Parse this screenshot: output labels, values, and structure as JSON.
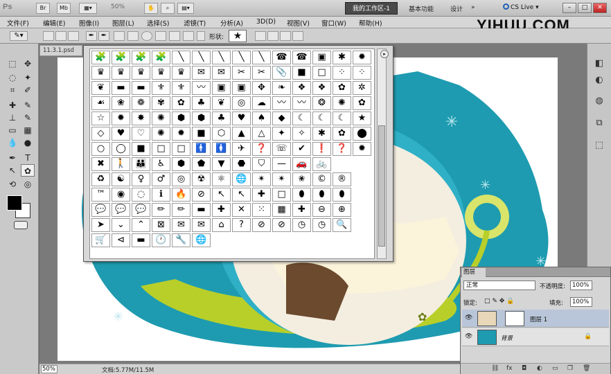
{
  "app": {
    "logo": "Ps",
    "zoom": "50%",
    "workspace": "我的工作区-1",
    "workspace_links": [
      "基本功能",
      "设计"
    ],
    "cs_live": "CS Live"
  },
  "menus": [
    "文件(F)",
    "编辑(E)",
    "图像(I)",
    "图层(L)",
    "选择(S)",
    "滤镜(T)",
    "分析(A)",
    "3D(D)",
    "视图(V)",
    "窗口(W)",
    "帮助(H)"
  ],
  "watermark_logo": "YIHUU.COM",
  "options": {
    "shape_label": "形状:"
  },
  "document": {
    "tab": "11.3.1.psd",
    "zoom": "50%",
    "doc_size": "文档:5.77M/11.5M"
  },
  "shapes": [
    "🧩",
    "🧩",
    "🧩",
    "🧩",
    "╲",
    "╲",
    "╲",
    "╲",
    "╲",
    "☎",
    "☎",
    "▣",
    "✱",
    "✹",
    "♛",
    "♛",
    "♛",
    "♛",
    "♛",
    "✉",
    "✉",
    "✂",
    "✂",
    "📎",
    "■",
    "□",
    "⁘",
    "⁘",
    "❦",
    "▬",
    "▬",
    "⚜",
    "⚜",
    "〰",
    "▣",
    "▣",
    "✥",
    "❧",
    "❖",
    "❖",
    "✿",
    "✲",
    "☙",
    "❀",
    "❁",
    "✾",
    "✿",
    "♣",
    "❦",
    "◎",
    "☁",
    "〰",
    "〰",
    "❂",
    "✺",
    "✿",
    "☆",
    "✹",
    "✸",
    "✺",
    "⬢",
    "⬢",
    "♣",
    "♥",
    "♠",
    "◆",
    "☾",
    "☾",
    "☾",
    "★",
    "◇",
    "♥",
    "♡",
    "✺",
    "✹",
    "■",
    "⬡",
    "▲",
    "△",
    "✦",
    "✧",
    "✱",
    "✿",
    "⬤",
    "○",
    "◯",
    "■",
    "□",
    "□",
    "🚹",
    "🚺",
    "✈",
    "❓",
    "☏",
    "✔",
    "❗",
    "❓",
    "✹",
    "✖",
    "🚶",
    "👪",
    "♿",
    "⬢",
    "⬟",
    "▼",
    "⬣",
    "⛉",
    "—",
    "🚗",
    "🚲",
    "",
    ""
  ],
  "shapes_row9": [
    "♻",
    "☯",
    "♀",
    "♂",
    "◎",
    "☢",
    "⚛",
    "🌐",
    "✴",
    "✴",
    "✬",
    "©",
    "®",
    ""
  ],
  "shapes_row10": [
    "™",
    "◉",
    "◌",
    "ℹ",
    "🔥",
    "⊘",
    "↖",
    "↖",
    "✚",
    "□",
    "⬮",
    "⬮",
    "⬮",
    ""
  ],
  "shapes_row11": [
    "💬",
    "💬",
    "💬",
    "✏",
    "✏",
    "▬",
    "✚",
    "✕",
    "⁙",
    "▦",
    "✚",
    "⊖",
    "⊕",
    ""
  ],
  "shapes_row12": [
    "➤",
    "⌄",
    "⌃",
    "⊠",
    "✉",
    "✉",
    "⌂",
    "?",
    "⊘",
    "⊘",
    "◷",
    "◷",
    "🔍",
    ""
  ],
  "shapes_row13": [
    "🛒",
    "⊲",
    "▬",
    "🕐",
    "🔧",
    "🌐",
    "",
    "",
    "",
    "",
    "",
    "",
    "",
    ""
  ],
  "layers": {
    "tab": "图层",
    "blend_mode": "正常",
    "opacity_label": "不透明度:",
    "opacity": "100%",
    "lock_label": "锁定:",
    "fill_label": "填充:",
    "fill": "100%",
    "items": [
      {
        "name": "图层 1"
      },
      {
        "name": "背景"
      }
    ]
  },
  "colors": {
    "canvas_teal": "#1e9bb0",
    "canvas_lime": "#b8cf2a",
    "workspace_btn": "#4a4a4a"
  }
}
